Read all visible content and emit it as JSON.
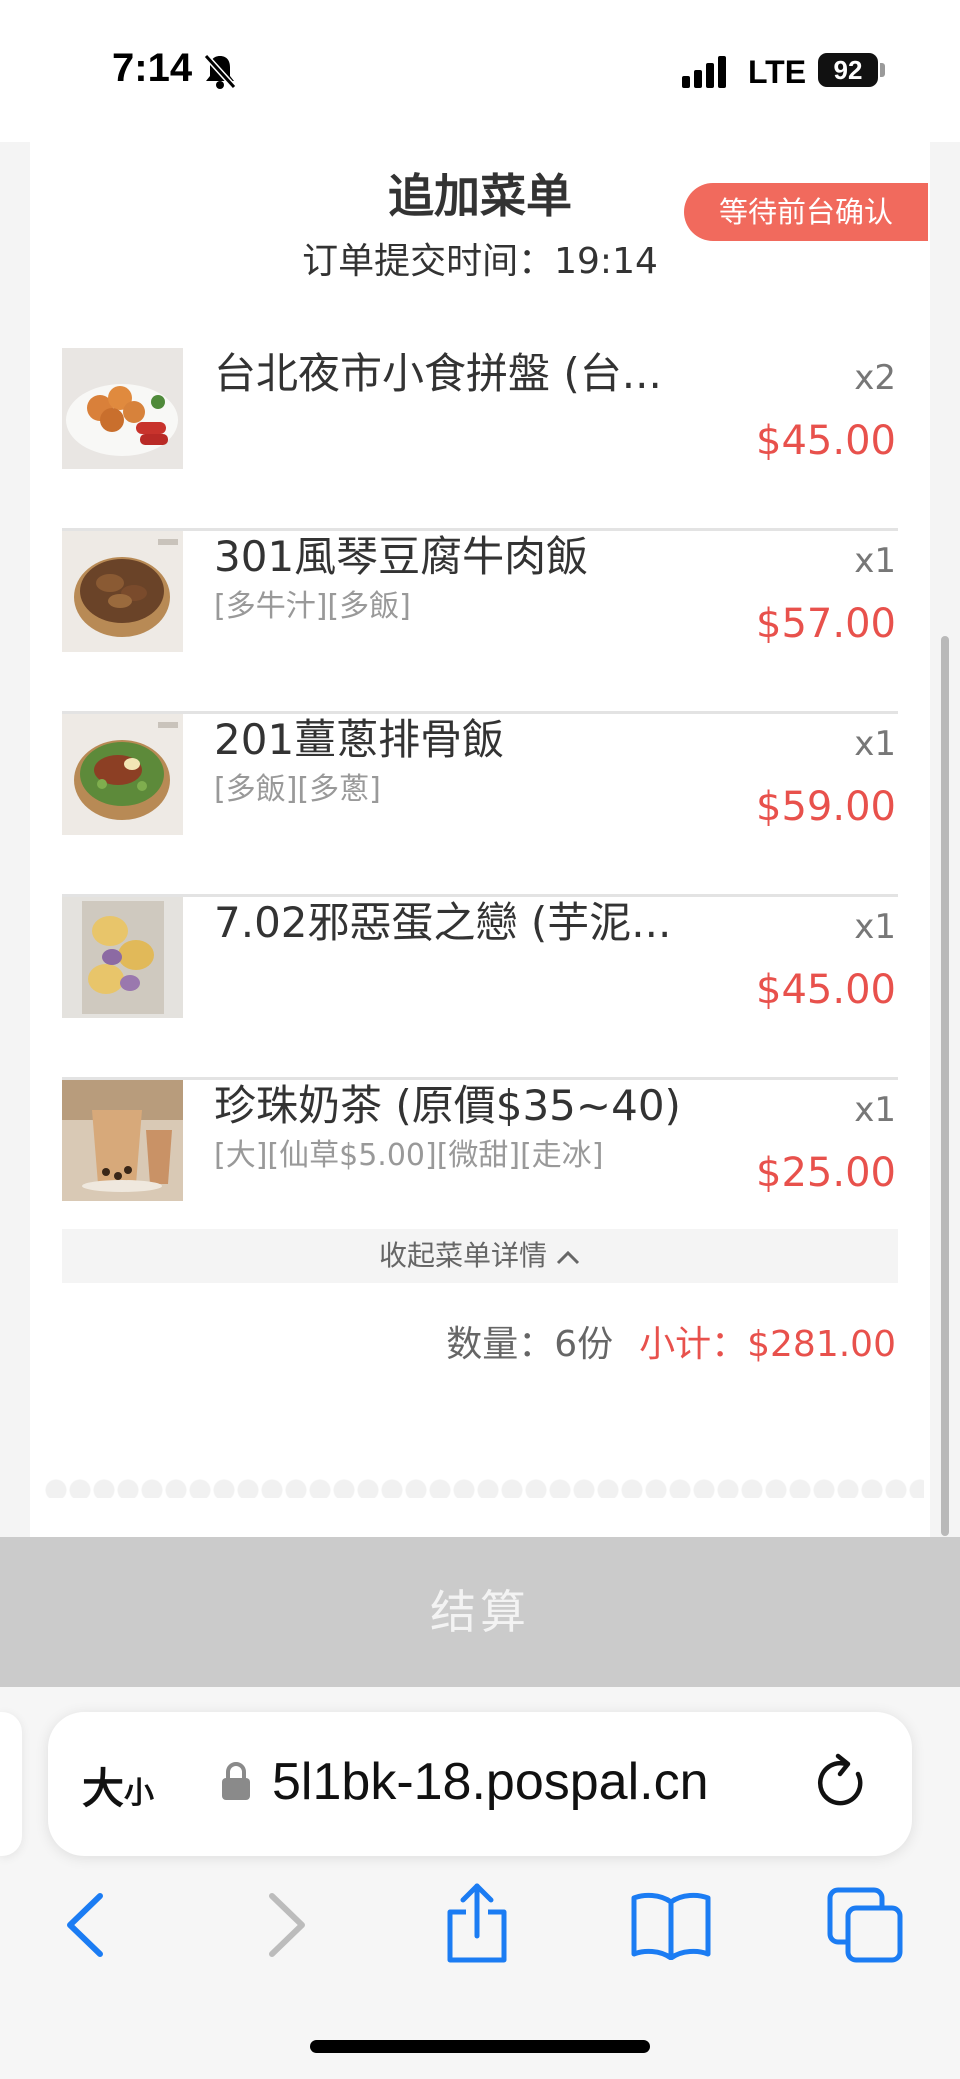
{
  "status_bar": {
    "time": "7:14",
    "network": "LTE",
    "battery": "92"
  },
  "order": {
    "title": "追加菜单",
    "submitted_label": "订单提交时间：19:14",
    "status_badge": "等待前台确认"
  },
  "items": [
    {
      "name": "台北夜市小食拼盤 (台...",
      "options": "",
      "qty": "x2",
      "price": "$45.00",
      "image": "fried-snack-platter"
    },
    {
      "name": "301風琴豆腐牛肉飯",
      "options": "[多牛汁][多飯]",
      "qty": "x1",
      "price": "$57.00",
      "image": "beef-tofu-rice-bowl"
    },
    {
      "name": "201薑蔥排骨飯",
      "options": "[多飯][多蔥]",
      "qty": "x1",
      "price": "$59.00",
      "image": "pork-chop-rice-bowl"
    },
    {
      "name": "7.02邪惡蛋之戀 (芋泥...",
      "options": "",
      "qty": "x1",
      "price": "$45.00",
      "image": "taro-egg-waffle"
    },
    {
      "name": "珍珠奶茶 (原價$35~40)",
      "options": "[大][仙草$5.00][微甜][走冰]",
      "qty": "x1",
      "price": "$25.00",
      "image": "bubble-milk-tea"
    }
  ],
  "collapse_label": "收起菜单详情",
  "summary": {
    "quantity": "数量：6份",
    "subtotal": "小计：$281.00"
  },
  "checkout_label": "结算",
  "browser": {
    "text_size_big": "大",
    "text_size_small": "小",
    "url": "5l1bk-18.pospal.cn"
  },
  "colors": {
    "accent": "#f16a5d",
    "price": "#e8514c",
    "checkout_bg": "#cbcbcb",
    "safari_blue": "#1b7cf3"
  }
}
